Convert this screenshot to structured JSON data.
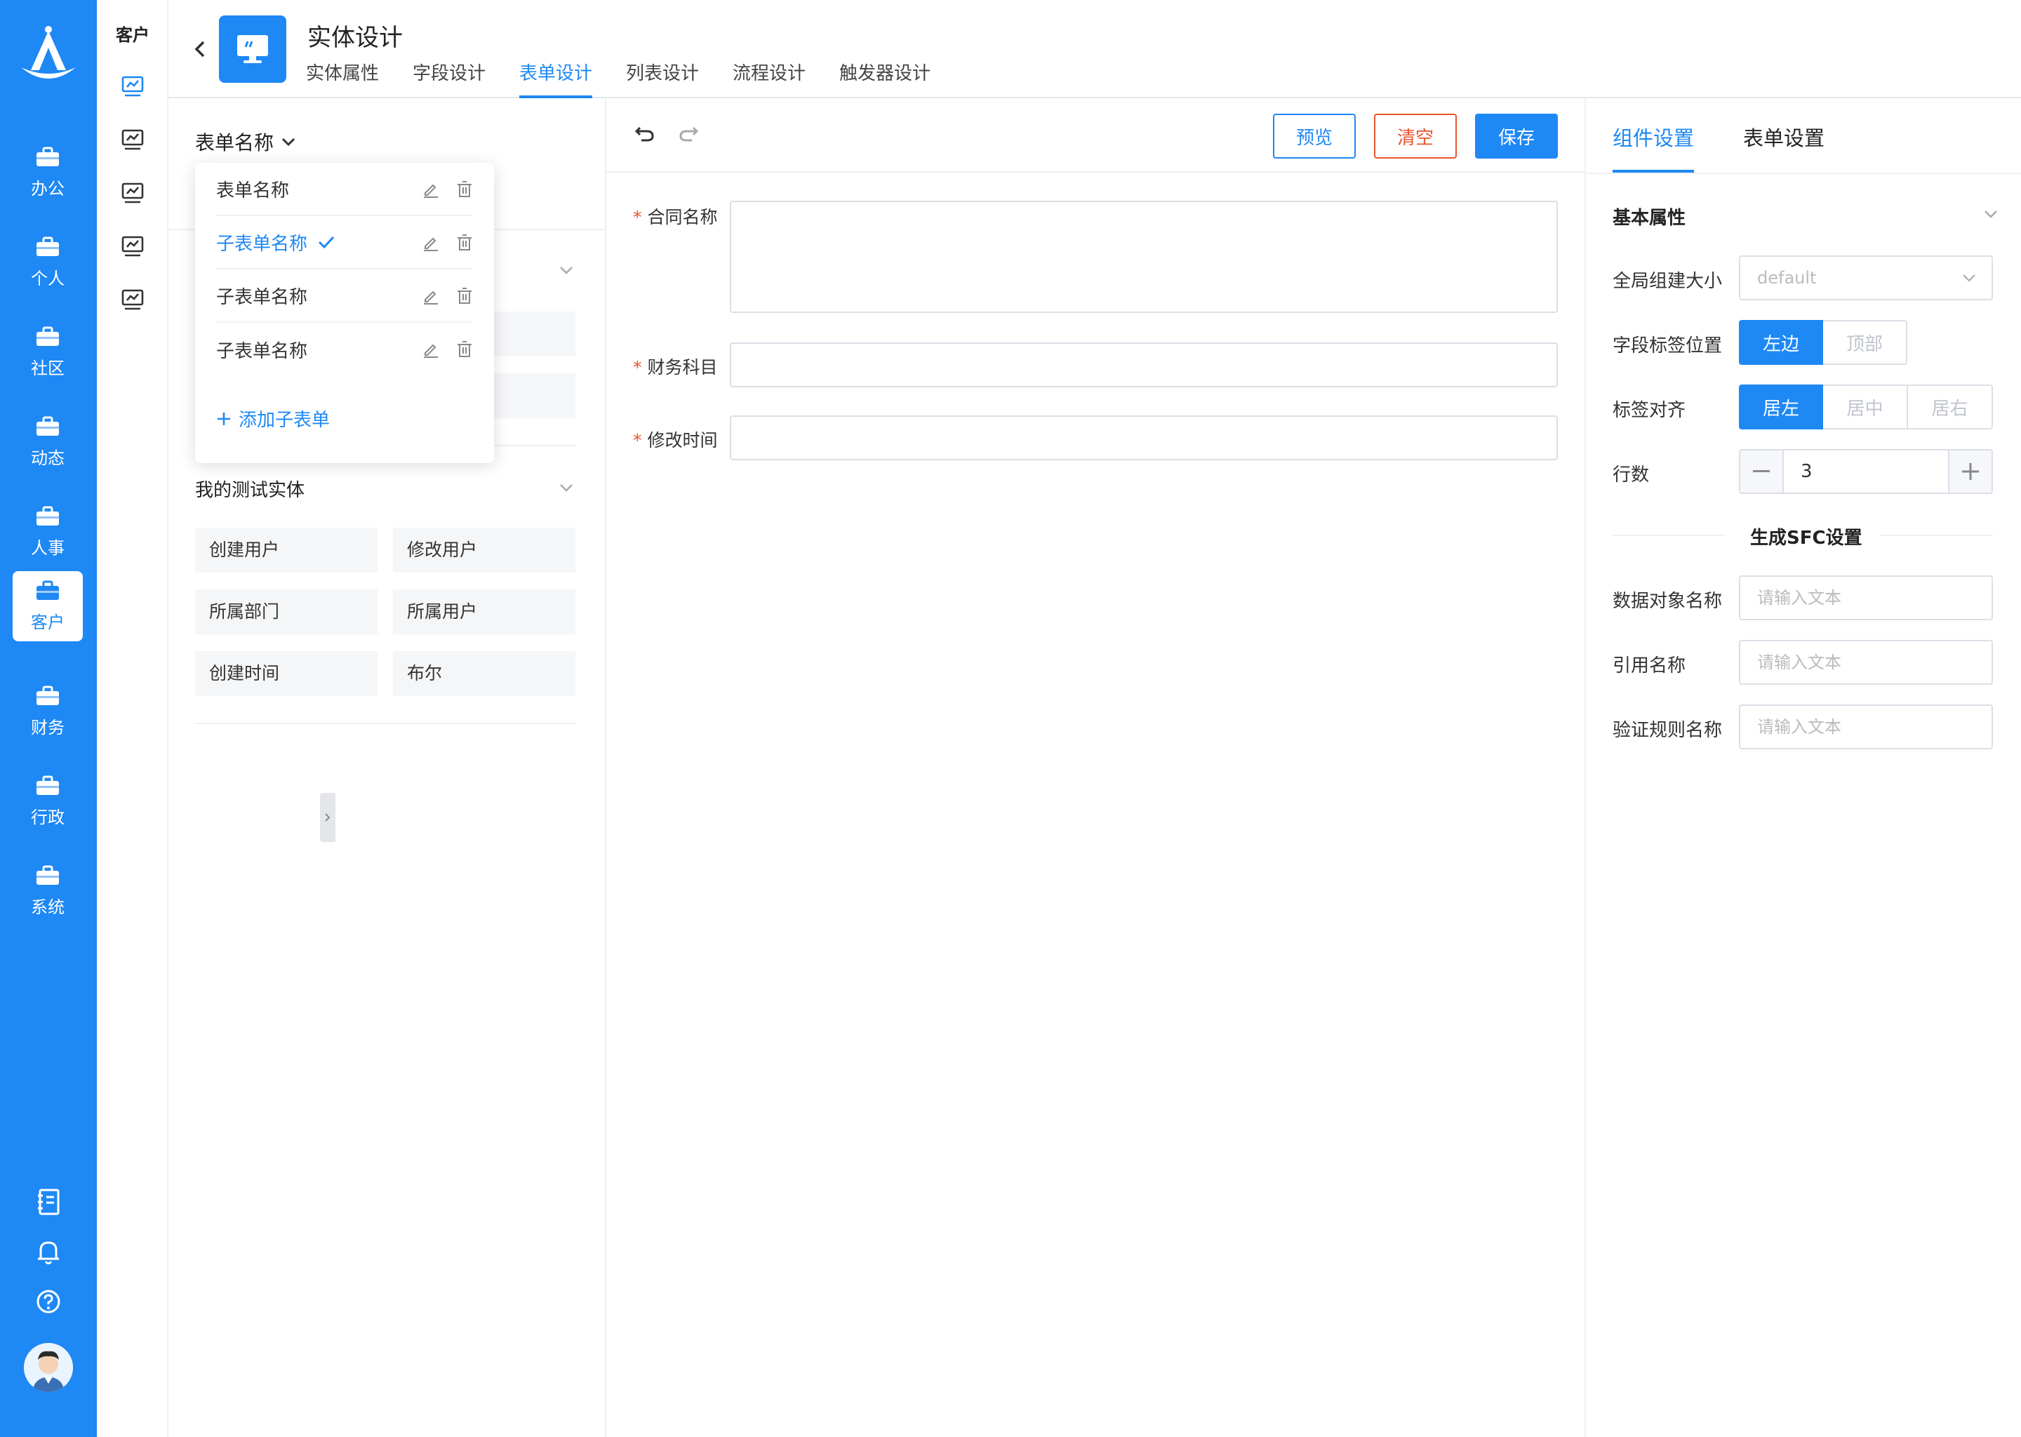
{
  "nav": {
    "items": [
      {
        "label": "办公",
        "icon": "briefcase-icon"
      },
      {
        "label": "个人",
        "icon": "briefcase-icon"
      },
      {
        "label": "社区",
        "icon": "briefcase-icon"
      },
      {
        "label": "动态",
        "icon": "briefcase-icon"
      },
      {
        "label": "人事",
        "icon": "briefcase-icon"
      },
      {
        "label": "客户",
        "icon": "briefcase-icon",
        "active": true
      },
      {
        "label": "财务",
        "icon": "briefcase-icon"
      },
      {
        "label": "行政",
        "icon": "briefcase-icon"
      },
      {
        "label": "系统",
        "icon": "briefcase-icon"
      }
    ],
    "bottom_icons": [
      "notebook-icon",
      "bell-icon",
      "help-icon"
    ],
    "accent": "#1E88F5"
  },
  "subnav": {
    "title": "客户",
    "icons": [
      "chart-monitor-icon",
      "chart-monitor-icon",
      "chart-monitor-icon",
      "chart-monitor-icon",
      "chart-monitor-icon"
    ]
  },
  "header": {
    "title": "实体设计",
    "tabs": [
      "实体属性",
      "字段设计",
      "表单设计",
      "列表设计",
      "流程设计",
      "触发器设计"
    ],
    "active_tab": "表单设计"
  },
  "left": {
    "form_select": "表单名称",
    "popover": {
      "items": [
        {
          "label": "表单名称"
        },
        {
          "label": "子表单名称",
          "selected": true
        },
        {
          "label": "子表单名称"
        },
        {
          "label": "子表单名称"
        }
      ],
      "add_label": "添加子表单"
    },
    "section": {
      "title": "我的测试实体",
      "fields": [
        "创建用户",
        "修改用户",
        "所属部门",
        "所属用户",
        "创建时间",
        "布尔"
      ]
    }
  },
  "canvas": {
    "buttons": {
      "preview": "预览",
      "clear": "清空",
      "save": "保存"
    },
    "fields": [
      {
        "label": "合同名称",
        "required": true
      },
      {
        "label": "财务科目",
        "required": true
      },
      {
        "label": "修改时间",
        "required": true
      }
    ]
  },
  "right": {
    "tabs": [
      "组件设置",
      "表单设置"
    ],
    "active_tab": "组件设置",
    "basic": {
      "title": "基本属性",
      "size_label": "全局组建大小",
      "size_value": "default",
      "label_pos_label": "字段标签位置",
      "label_pos_options": [
        "左边",
        "顶部"
      ],
      "label_pos_selected": "左边",
      "align_label": "标签对齐",
      "align_options": [
        "居左",
        "居中",
        "居右"
      ],
      "align_selected": "居左",
      "rows_label": "行数",
      "rows_value": "3"
    },
    "sfc": {
      "title": "生成SFC设置",
      "fields": [
        {
          "label": "数据对象名称",
          "placeholder": "请输入文本"
        },
        {
          "label": "引用名称",
          "placeholder": "请输入文本"
        },
        {
          "label": "验证规则名称",
          "placeholder": "请输入文本"
        }
      ]
    }
  }
}
